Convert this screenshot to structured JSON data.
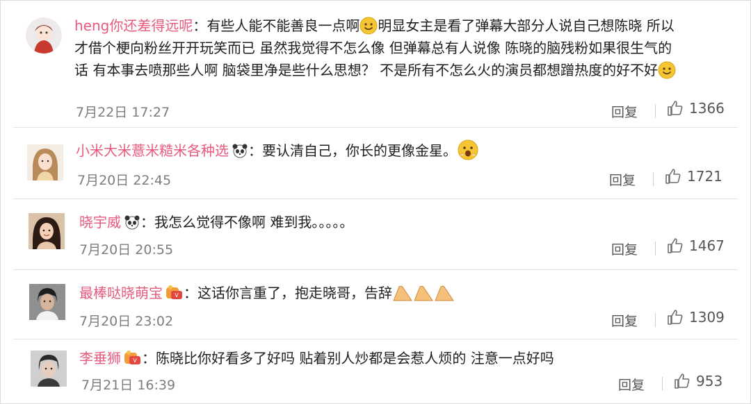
{
  "comments": [
    {
      "username": "heng你还差得远呢",
      "lines": [
        "有些人能不能善良一点啊",
        "明显女主是看了弹幕大部分人说自己想陈晓 所以",
        "才借个梗向粉丝开开玩笑而已 虽然我觉得不怎么像 但弹幕总有人说像 陈晓的脑残粉如果很生气的",
        "话 有本事去喷那些人啊 脑袋里净是些什么思想？ 不是所有不怎么火的演员都想蹭热度的好不好"
      ],
      "time": "7月22日 17:27",
      "reply_label": "回复",
      "likes": "1366"
    },
    {
      "username": "小米大米薏米糙米各种选",
      "text": "要认清自己，你长的更像金星。",
      "time": "7月20日 22:45",
      "reply_label": "回复",
      "likes": "1721"
    },
    {
      "username": "晓宇威",
      "text": "我怎么觉得不像啊  难到我。。。。。",
      "time": "7月20日 20:55",
      "reply_label": "回复",
      "likes": "1467"
    },
    {
      "username": "最棒哒晓萌宝",
      "text": "这话你言重了，抱走晓哥，告辞",
      "time": "7月20日 23:02",
      "reply_label": "回复",
      "likes": "1309"
    },
    {
      "username": "李垂狮",
      "text": "陈晓比你好看多了好吗   贴着别人炒都是会惹人烦的  注意一点好吗",
      "time": "7月21日 16:39",
      "reply_label": "回复",
      "likes": "953"
    }
  ],
  "colon": "：",
  "colors": {
    "username": "#e75a7c",
    "text": "#1e1e1e",
    "meta": "#7d7d7d",
    "emoji": "#f6c533"
  },
  "icons": [
    "smile-emoji",
    "panda-icon",
    "gasp-emoji",
    "vip-badge-icon",
    "clap-emoji",
    "thumbs-up-icon"
  ]
}
